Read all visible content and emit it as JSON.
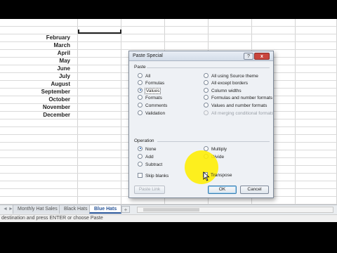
{
  "months": [
    "February",
    "March",
    "April",
    "May",
    "June",
    "July",
    "August",
    "September",
    "October",
    "November",
    "December"
  ],
  "sheet_tabs": {
    "nav_prev": "◄",
    "nav_next": "►",
    "tabs": [
      "Monthly Hat Sales",
      "Black Hats",
      "Blue Hats"
    ],
    "active_index": 2,
    "add": "+"
  },
  "status_bar": "destination and press ENTER or choose Paste",
  "dialog": {
    "title": "Paste Special",
    "help": "?",
    "close": "x",
    "paste_group": "Paste",
    "paste_left": [
      {
        "label": "All",
        "selected": false
      },
      {
        "label": "Formulas",
        "selected": false
      },
      {
        "label": "Values",
        "selected": true
      },
      {
        "label": "Formats",
        "selected": false
      },
      {
        "label": "Comments",
        "selected": false
      },
      {
        "label": "Validation",
        "selected": false
      }
    ],
    "paste_right": [
      {
        "label": "All using Source theme",
        "disabled": false
      },
      {
        "label": "All except borders",
        "disabled": false
      },
      {
        "label": "Column widths",
        "disabled": false
      },
      {
        "label": "Formulas and number formats",
        "disabled": false
      },
      {
        "label": "Values and number formats",
        "disabled": false
      },
      {
        "label": "All merging conditional formats",
        "disabled": true
      }
    ],
    "operation_group": "Operation",
    "operation_left": [
      {
        "label": "None",
        "selected": true
      },
      {
        "label": "Add",
        "selected": false
      },
      {
        "label": "Subtract",
        "selected": false
      }
    ],
    "operation_right": [
      {
        "label": "Multiply",
        "selected": false
      },
      {
        "label": "Divide",
        "selected": false
      }
    ],
    "skip_blanks": "Skip blanks",
    "transpose": "Transpose",
    "paste_link": "Paste Link",
    "ok": "OK",
    "cancel": "Cancel"
  },
  "colors": {
    "highlight_spot": "#ffee00",
    "active_tab_text": "#2b579a"
  }
}
